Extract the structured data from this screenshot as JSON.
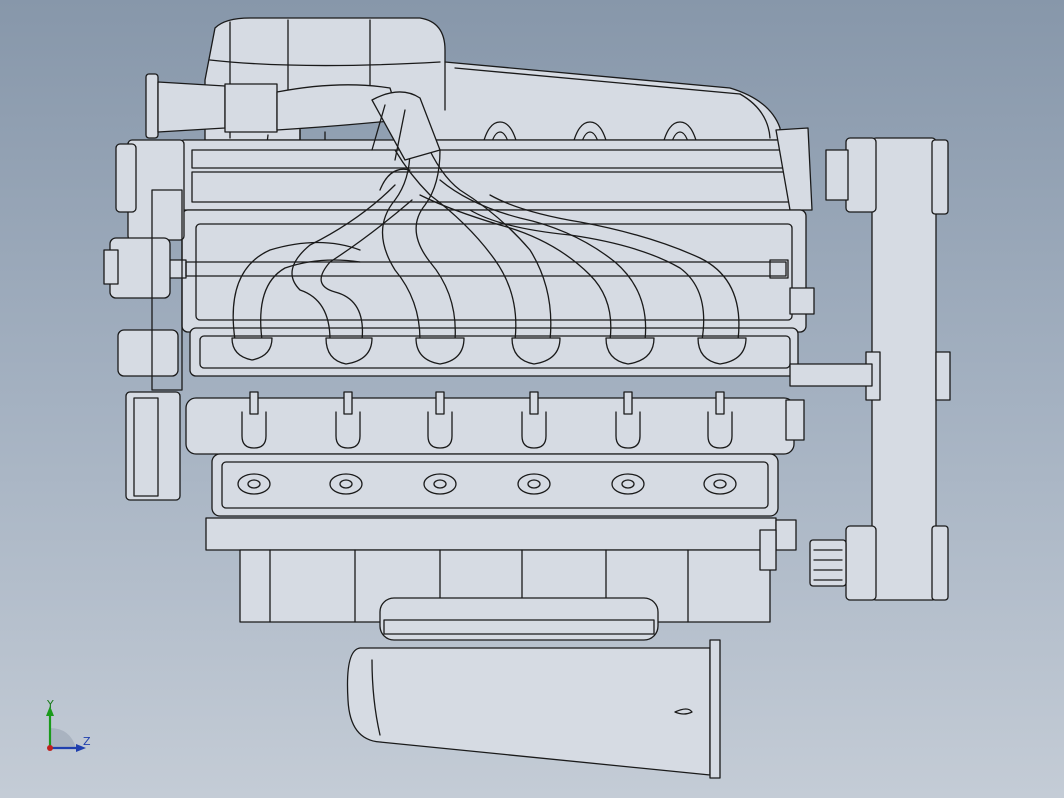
{
  "viewport": {
    "view": "engine-assembly-top-view",
    "background_top": "#8797aa",
    "background_bottom": "#c4ccd6",
    "line_color": "#1a1a1a",
    "fill_color": "#d6dbe3"
  },
  "triad": {
    "y_label": "Y",
    "z_label": "Z",
    "y_color": "#1a9a1a",
    "z_color": "#1f3fae",
    "origin_color": "#c0201e"
  }
}
